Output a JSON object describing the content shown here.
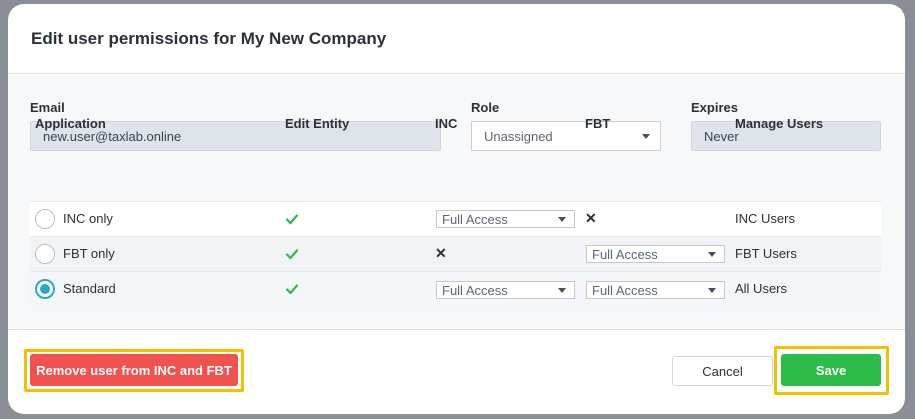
{
  "dialog": {
    "title": "Edit user permissions for My New Company"
  },
  "form": {
    "email_label": "Email",
    "email_value": "new.user@taxlab.online",
    "role_label": "Role",
    "role_value": "Unassigned",
    "expires_label": "Expires",
    "expires_value": "Never"
  },
  "table": {
    "headers": [
      "Application",
      "Edit Entity",
      "INC",
      "FBT",
      "Manage Users"
    ],
    "rows": [
      {
        "application": "INC only",
        "selected": false,
        "edit_entity": "check-icon",
        "inc": "Full Access",
        "fbt": "cross-icon",
        "manage_users": "INC Users"
      },
      {
        "application": "FBT only",
        "selected": false,
        "edit_entity": "check-icon",
        "inc": "cross-icon",
        "fbt": "Full Access",
        "manage_users": "FBT Users"
      },
      {
        "application": "Standard",
        "selected": true,
        "edit_entity": "check-icon",
        "inc": "Full Access",
        "fbt": "Full Access",
        "manage_users": "All Users"
      }
    ]
  },
  "footer": {
    "remove_label": "Remove user from INC and FBT",
    "cancel_label": "Cancel",
    "save_label": "Save"
  },
  "colors": {
    "accent": "#2aa9c7",
    "check": "#2dbb4a",
    "danger": "#f0524f",
    "save": "#2dbb4a",
    "highlight": "#f5c000"
  }
}
